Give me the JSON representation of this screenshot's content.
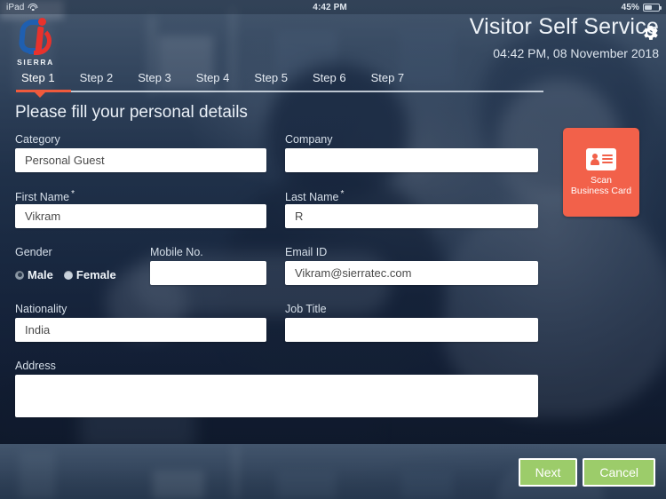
{
  "status_bar": {
    "device": "iPad",
    "wifi_icon": "wifi-icon",
    "time": "4:42 PM",
    "battery_percent": "45%",
    "battery_icon": "battery-icon"
  },
  "header": {
    "logo_text": "SIERRA",
    "title": "Visitor Self Service",
    "datetime": "04:42 PM, 08 November 2018",
    "settings_icon": "gear-icon"
  },
  "steps": {
    "items": [
      {
        "label": "Step 1",
        "active": true
      },
      {
        "label": "Step 2",
        "active": false
      },
      {
        "label": "Step 3",
        "active": false
      },
      {
        "label": "Step 4",
        "active": false
      },
      {
        "label": "Step 5",
        "active": false
      },
      {
        "label": "Step 6",
        "active": false
      },
      {
        "label": "Step 7",
        "active": false
      }
    ]
  },
  "form": {
    "section_title": "Please fill your personal details",
    "category": {
      "label": "Category",
      "value": "Personal Guest",
      "placeholder": ""
    },
    "company": {
      "label": "Company",
      "value": "",
      "placeholder": ""
    },
    "first_name": {
      "label": "First Name",
      "required_marker": "*",
      "value": "Vikram",
      "placeholder": ""
    },
    "last_name": {
      "label": "Last Name",
      "required_marker": "*",
      "value": "R",
      "placeholder": ""
    },
    "gender": {
      "label": "Gender",
      "options": [
        {
          "label": "Male",
          "selected": true
        },
        {
          "label": "Female",
          "selected": false
        }
      ]
    },
    "mobile_no": {
      "label": "Mobile No.",
      "value": "",
      "placeholder": ""
    },
    "email_id": {
      "label": "Email ID",
      "value": "Vikram@sierratec.com",
      "placeholder": ""
    },
    "nationality": {
      "label": "Nationality",
      "value": "India",
      "placeholder": ""
    },
    "job_title": {
      "label": "Job Title",
      "value": "",
      "placeholder": ""
    },
    "address": {
      "label": "Address",
      "value": "",
      "placeholder": ""
    }
  },
  "scan_button": {
    "icon": "id-card-icon",
    "line1": "Scan",
    "line2": "Business Card"
  },
  "footer": {
    "next_label": "Next",
    "cancel_label": "Cancel"
  },
  "colors": {
    "accent_orange": "#f05a3c",
    "scan_orange": "#f2614a",
    "button_green": "#9ccc6a",
    "logo_blue": "#1f5fb0",
    "logo_red": "#e8322c"
  }
}
